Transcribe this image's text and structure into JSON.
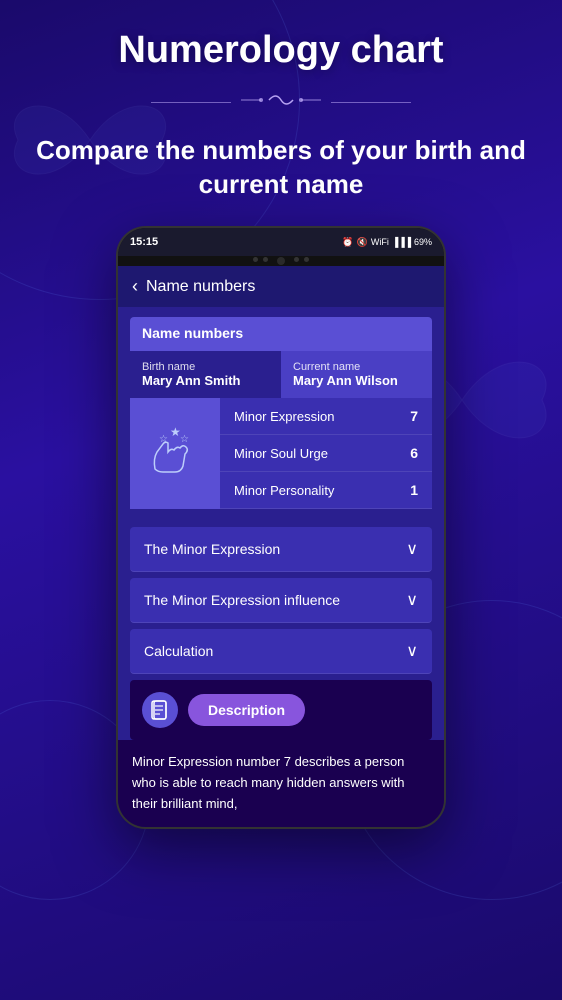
{
  "header": {
    "title": "Numerology chart",
    "divider_ornament": "〜∞〜",
    "subtitle": "Compare the numbers of your birth and current name"
  },
  "phone": {
    "status_time": "15:15",
    "status_battery": "69%"
  },
  "app": {
    "nav_back": "‹",
    "nav_title": "Name numbers",
    "section_label": "Name numbers",
    "birth_tab_label": "Birth name",
    "birth_tab_value": "Mary Ann Smith",
    "current_tab_label": "Current name",
    "current_tab_value": "Mary Ann Wilson",
    "numbers": [
      {
        "label": "Minor Expression",
        "value": "7"
      },
      {
        "label": "Minor Soul Urge",
        "value": "6"
      },
      {
        "label": "Minor Personality",
        "value": "1"
      }
    ],
    "accordions": [
      {
        "label": "The Minor Expression"
      },
      {
        "label": "The Minor Expression influence"
      },
      {
        "label": "Calculation"
      }
    ],
    "desc_button": "Description",
    "desc_text": "Minor Expression number 7 describes a person who is able to reach many hidden answers with their brilliant mind,"
  }
}
